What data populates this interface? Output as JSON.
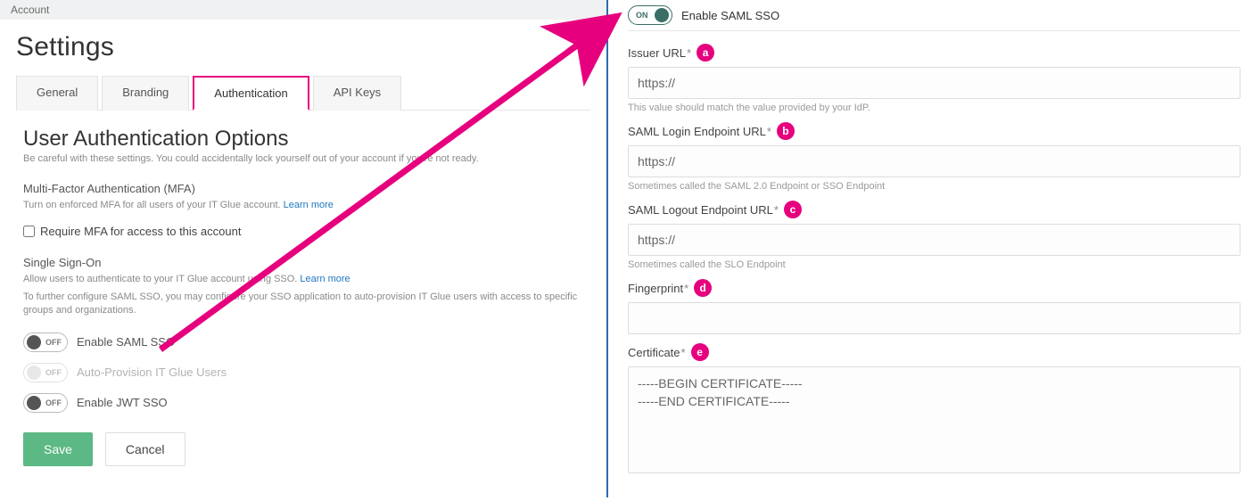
{
  "breadcrumb": "Account",
  "page_title": "Settings",
  "tabs": [
    "General",
    "Branding",
    "Authentication",
    "API Keys"
  ],
  "active_tab": "Authentication",
  "auth": {
    "title": "User Authentication Options",
    "subtitle": "Be careful with these settings. You could accidentally lock yourself out of your account if you're not ready.",
    "mfa_heading": "Multi-Factor Authentication (MFA)",
    "mfa_help": "Turn on enforced MFA for all users of your IT Glue account.",
    "learn_more": "Learn more",
    "require_mfa_label": "Require MFA for access to this account",
    "sso_heading": "Single Sign-On",
    "sso_help1": "Allow users to authenticate to your IT Glue account using SSO.",
    "sso_help2": "To further configure SAML SSO, you may configure your SSO application to auto-provision IT Glue users with access to specific groups and organizations.",
    "toggle_off": "OFF",
    "toggle_on": "ON",
    "enable_saml_label": "Enable SAML SSO",
    "auto_provision_label": "Auto-Provision IT Glue Users",
    "enable_jwt_label": "Enable JWT SSO",
    "save_btn": "Save",
    "cancel_btn": "Cancel"
  },
  "saml_panel": {
    "enable_label": "Enable SAML SSO",
    "fields": {
      "issuer": {
        "label": "Issuer URL",
        "value": "https://",
        "hint": "This value should match the value provided by your IdP.",
        "marker": "a"
      },
      "login": {
        "label": "SAML Login Endpoint URL",
        "value": "https://",
        "hint": "Sometimes called the SAML 2.0 Endpoint or SSO Endpoint",
        "marker": "b"
      },
      "logout": {
        "label": "SAML Logout Endpoint URL",
        "value": "https://",
        "hint": "Sometimes called the SLO Endpoint",
        "marker": "c"
      },
      "fingerprint": {
        "label": "Fingerprint",
        "value": "",
        "marker": "d"
      },
      "certificate": {
        "label": "Certificate",
        "value": "-----BEGIN CERTIFICATE-----\n-----END CERTIFICATE-----",
        "marker": "e"
      }
    }
  }
}
